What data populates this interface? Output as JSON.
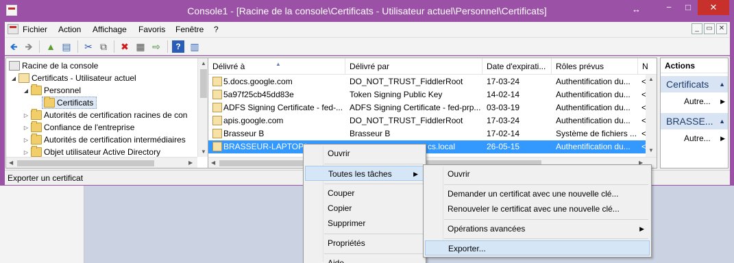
{
  "window": {
    "title": "Console1 - [Racine de la console\\Certificats - Utilisateur actuel\\Personnel\\Certificats]",
    "resize_glyph": "↔",
    "min": "−",
    "max": "□",
    "close": "✕"
  },
  "menubar": {
    "items": [
      "Fichier",
      "Action",
      "Affichage",
      "Favoris",
      "Fenêtre",
      "?"
    ],
    "mdi": [
      "_",
      "▭",
      "✕"
    ]
  },
  "toolbar": {
    "back": "🡸",
    "forward": "🡺",
    "up": "▲",
    "show_tree": "▤",
    "cut": "✂",
    "copy": "⧉",
    "delete": "✖",
    "properties": "▦",
    "export": "⇨",
    "help": "?",
    "show_action": "▥"
  },
  "tree": {
    "items": [
      {
        "label": "Racine de la console"
      },
      {
        "label": "Certificats - Utilisateur actuel"
      },
      {
        "label": "Personnel"
      },
      {
        "label": "Certificats"
      },
      {
        "label": "Autorités de certification racines de con"
      },
      {
        "label": "Confiance de l'entreprise"
      },
      {
        "label": "Autorités de certification intermédiaires"
      },
      {
        "label": "Objet utilisateur Active Directory"
      }
    ]
  },
  "list": {
    "columns": [
      "Délivré à",
      "Délivré par",
      "Date d'expirati...",
      "Rôles prévus",
      "N"
    ],
    "rows": [
      {
        "issued_to": "5.docs.google.com",
        "issued_by": "DO_NOT_TRUST_FiddlerRoot",
        "expiry": "17-03-24",
        "roles": "Authentification du...",
        "n": "<"
      },
      {
        "issued_to": "5a97f25cb45dd83e",
        "issued_by": "Token Signing Public Key",
        "expiry": "14-02-14",
        "roles": "Authentification du...",
        "n": "<"
      },
      {
        "issued_to": "ADFS Signing Certificate - fed-...",
        "issued_by": "ADFS Signing Certificate - fed-prp...",
        "expiry": "03-03-19",
        "roles": "Authentification du...",
        "n": "<"
      },
      {
        "issued_to": "apis.google.com",
        "issued_by": "DO_NOT_TRUST_FiddlerRoot",
        "expiry": "17-03-24",
        "roles": "Authentification du...",
        "n": "<"
      },
      {
        "issued_to": "Brasseur B",
        "issued_by": "Brasseur B",
        "expiry": "17-02-14",
        "roles": "Système de fichiers ...",
        "n": "<"
      },
      {
        "issued_to": "BRASSEUR-LAPTOP.b",
        "issued_by": "cs.local",
        "expiry": "26-05-15",
        "roles": "Authentification du...",
        "n": "<"
      }
    ]
  },
  "actions": {
    "header": "Actions",
    "group1": "Certificats",
    "item1": "Autre...",
    "group2": "BRASSE...",
    "item2": "Autre..."
  },
  "status": {
    "text": "Exporter un certificat"
  },
  "context_menu": {
    "items": [
      "Ouvrir",
      "Toutes les tâches",
      "Couper",
      "Copier",
      "Supprimer",
      "Propriétés",
      "Aide"
    ]
  },
  "submenu": {
    "items": [
      "Ouvrir",
      "Demander un certificat avec une nouvelle clé...",
      "Renouveler le certificat avec une nouvelle clé...",
      "Opérations avancées",
      "Exporter..."
    ]
  }
}
